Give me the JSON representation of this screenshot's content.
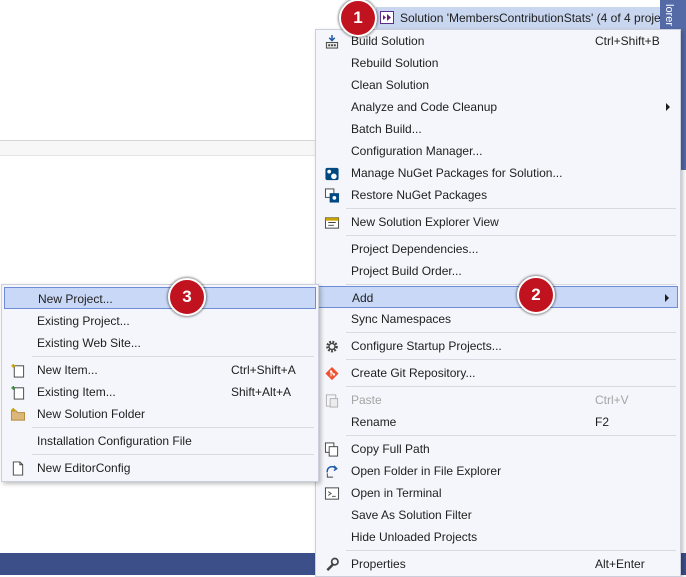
{
  "solution_bar": {
    "text": "Solution 'MembersContributionStats' (4 of 4 proje",
    "side_tab": "lorer"
  },
  "context_menu": {
    "items": [
      {
        "label": "Build Solution",
        "shortcut": "Ctrl+Shift+B",
        "icon": "build-icon"
      },
      {
        "label": "Rebuild Solution"
      },
      {
        "label": "Clean Solution"
      },
      {
        "label": "Analyze and Code Cleanup",
        "submenu": true
      },
      {
        "label": "Batch Build..."
      },
      {
        "label": "Configuration Manager..."
      },
      {
        "label": "Manage NuGet Packages for Solution...",
        "icon": "nuget-icon"
      },
      {
        "label": "Restore NuGet Packages",
        "icon": "restore-icon"
      },
      {
        "label": "New Solution Explorer View",
        "icon": "explorer-view-icon"
      },
      {
        "label": "Project Dependencies..."
      },
      {
        "label": "Project Build Order..."
      },
      {
        "label": "Add",
        "submenu": true,
        "highlighted": true
      },
      {
        "label": "Sync Namespaces"
      },
      {
        "label": "Configure Startup Projects...",
        "icon": "gear-icon"
      },
      {
        "label": "Create Git Repository...",
        "icon": "git-icon"
      },
      {
        "label": "Paste",
        "shortcut": "Ctrl+V",
        "icon": "paste-icon",
        "disabled": true
      },
      {
        "label": "Rename",
        "shortcut": "F2"
      },
      {
        "label": "Copy Full Path",
        "icon": "copy-icon"
      },
      {
        "label": "Open Folder in File Explorer",
        "icon": "open-folder-icon"
      },
      {
        "label": "Open in Terminal",
        "icon": "terminal-icon"
      },
      {
        "label": "Save As Solution Filter"
      },
      {
        "label": "Hide Unloaded Projects"
      },
      {
        "label": "Properties",
        "shortcut": "Alt+Enter",
        "icon": "wrench-icon"
      }
    ]
  },
  "add_submenu": {
    "items": [
      {
        "label": "New Project...",
        "highlighted": true
      },
      {
        "label": "Existing Project..."
      },
      {
        "label": "Existing Web Site..."
      },
      {
        "label": "New Item...",
        "shortcut": "Ctrl+Shift+A",
        "icon": "new-item-icon"
      },
      {
        "label": "Existing Item...",
        "shortcut": "Shift+Alt+A",
        "icon": "existing-item-icon"
      },
      {
        "label": "New Solution Folder",
        "icon": "folder-icon"
      },
      {
        "label": "Installation Configuration File"
      },
      {
        "label": "New EditorConfig",
        "icon": "file-icon"
      }
    ]
  },
  "callouts": [
    "1",
    "2",
    "3"
  ],
  "colors": {
    "accent": "#c1121f",
    "highlight": "#c9d8f6",
    "highlight_border": "#6d8dd6",
    "menu_bg": "#f5f6fb",
    "title_bar": "#3c4f88"
  }
}
